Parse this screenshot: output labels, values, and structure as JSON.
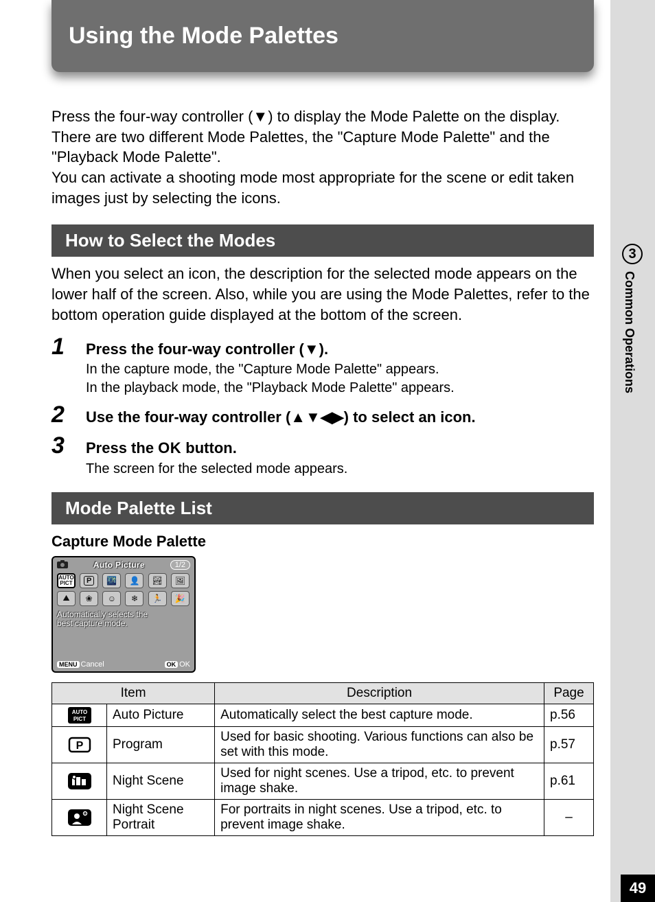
{
  "chapter": {
    "number": "3",
    "label": "Common Operations"
  },
  "page_number": "49",
  "title": "Using the Mode Palettes",
  "intro": "Press the four-way controller (▼) to display the Mode Palette on the display. There are two different Mode Palettes, the \"Capture Mode Palette\" and the \"Playback Mode Palette\".\nYou can activate a shooting mode most appropriate for the scene or edit taken images just by selecting the icons.",
  "section1_title": "How to Select the Modes",
  "section1_intro": "When you select an icon, the description for the selected mode appears on the lower half of the screen. Also, while you are using the Mode Palettes, refer to the bottom operation guide displayed at the bottom of the screen.",
  "steps": [
    {
      "num": "1",
      "title": "Press the four-way controller (▼).",
      "desc": "In the capture mode, the \"Capture Mode Palette\" appears.\nIn the playback mode, the \"Playback Mode Palette\" appears."
    },
    {
      "num": "2",
      "title": "Use the four-way controller (▲▼◀▶) to select an icon.",
      "desc": ""
    },
    {
      "num": "3",
      "title_pre": "Press the ",
      "ok": "OK",
      "title_post": " button.",
      "desc": "The screen for the selected mode appears."
    }
  ],
  "section2_title": "Mode Palette List",
  "subhead": "Capture Mode Palette",
  "lcd": {
    "topTitle": "Auto Picture",
    "pageIndicator": "1/2",
    "desc_line1": "Automatically selects the",
    "desc_line2": "best capture mode.",
    "menu_label": "MENU",
    "cancel": "Cancel",
    "ok_label": "OK",
    "ok_text": "OK"
  },
  "table": {
    "headers": {
      "item": "Item",
      "description": "Description",
      "page": "Page"
    },
    "rows": [
      {
        "icon": "auto-pict",
        "name": "Auto Picture",
        "desc": "Automatically select the best capture mode.",
        "page": "p.56"
      },
      {
        "icon": "program",
        "name": "Program",
        "desc": "Used for basic shooting. Various functions can also be set with this mode.",
        "page": "p.57"
      },
      {
        "icon": "night-scene",
        "name": "Night Scene",
        "desc": "Used for night scenes. Use a tripod, etc. to prevent image shake.",
        "page": "p.61"
      },
      {
        "icon": "night-portrait",
        "name": "Night Scene Portrait",
        "desc": "For portraits in night scenes. Use a tripod, etc. to prevent image shake.",
        "page": "–"
      }
    ]
  }
}
